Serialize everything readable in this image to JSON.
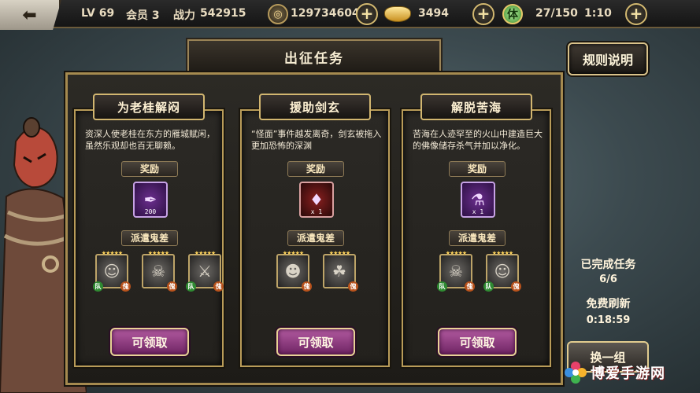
{
  "topbar": {
    "level": "LV 69",
    "vip": "会员 3",
    "power_label": "战力",
    "power_value": "542915",
    "coins": "129734604",
    "ingots": "3494",
    "stamina_icon_text": "体",
    "stamina": "27/150",
    "timer": "1:10",
    "plus_label": "+"
  },
  "header": {
    "title": "出征任务",
    "rules_button": "规则说明"
  },
  "cards": [
    {
      "title": "为老桂解闷",
      "description": "资深人使老桂在东方的雁城赋闲，虽然乐观却也百无聊赖。",
      "reward_label": "奖励",
      "reward_count": "200",
      "dispatch_label": "派遣鬼差",
      "claim_label": "可领取"
    },
    {
      "title": "援助剑玄",
      "description": "“怪面”事件越发离奇，剑玄被拖入更加恐怖的深渊",
      "reward_label": "奖励",
      "reward_count": "x 1",
      "dispatch_label": "派遣鬼差",
      "claim_label": "可领取"
    },
    {
      "title": "解脱苦海",
      "description": "苦海在人迹罕至的火山中建造巨大的佛像储存杀气并加以净化。",
      "reward_label": "奖励",
      "reward_count": "x 1",
      "dispatch_label": "派遣鬼差",
      "claim_label": "可领取"
    }
  ],
  "hero_tags": {
    "left": "队",
    "right": "傀"
  },
  "side": {
    "completed_label": "已完成任务",
    "completed_value": "6/6",
    "free_refresh_label": "免费刷新",
    "refresh_timer": "0:18:59",
    "change_button": "换一组"
  },
  "watermark": {
    "text": "博爱手游网"
  },
  "colors": {
    "gold_border": "#b99c59",
    "claim_button": "#9a3f8c",
    "star": "#ffd45c"
  }
}
